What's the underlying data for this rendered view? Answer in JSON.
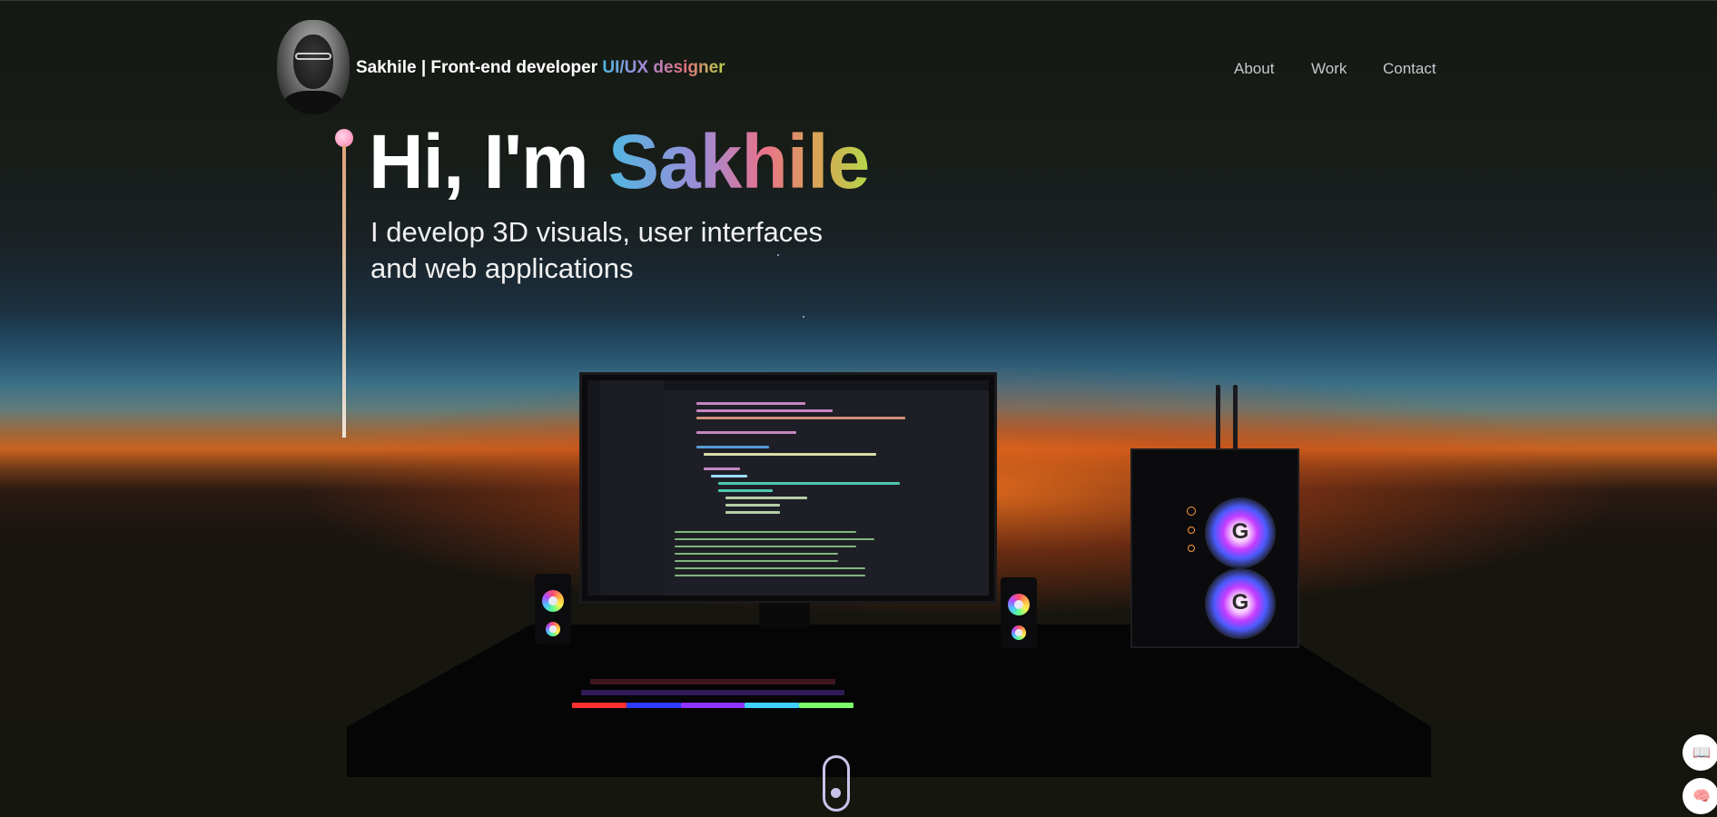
{
  "header": {
    "brand_name": "Sakhile",
    "brand_separator": " | ",
    "brand_role": "Front-end developer ",
    "brand_uiux": "UI/UX designer"
  },
  "nav": {
    "items": [
      {
        "label": "About"
      },
      {
        "label": "Work"
      },
      {
        "label": "Contact"
      }
    ]
  },
  "hero": {
    "greeting": "Hi, I'm ",
    "name": "Sakhile",
    "subtitle": "I develop 3D visuals, user interfaces and web applications"
  },
  "colors": {
    "accent_gradient": [
      "#4fb7e0",
      "#9d8cd8",
      "#e9728a",
      "#d9a456",
      "#b5d64a"
    ],
    "timeline_dot": "#ff9ec4",
    "nav_text": "#c5c7cc",
    "scroll_indicator": "#c9c2e8"
  },
  "icons": {
    "side_button_1": "book-icon",
    "side_button_2": "brain-icon"
  }
}
